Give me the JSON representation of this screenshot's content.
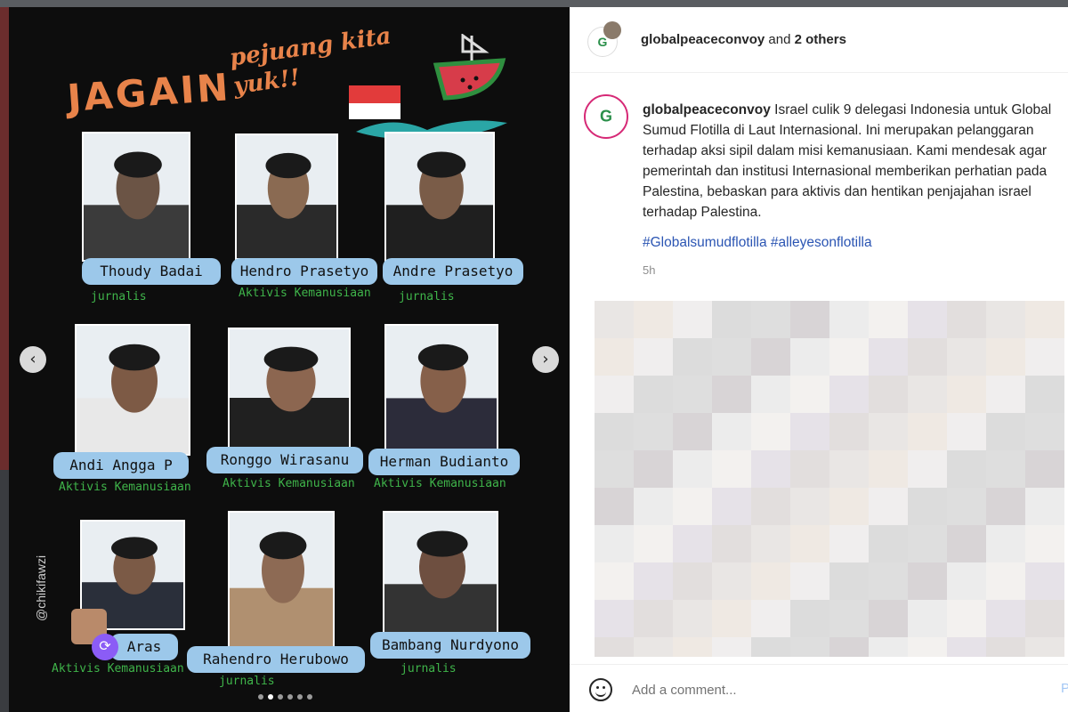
{
  "post": {
    "graphic": {
      "title": "JAGAIN",
      "subtitle": "pejuang kita yuk!!",
      "watermark": "@chikifawzi",
      "people": [
        {
          "name": "Thoudy Badai",
          "role": "jurnalis"
        },
        {
          "name": "Hendro Prasetyo",
          "role": "Aktivis Kemanusiaan"
        },
        {
          "name": "Andre Prasetyo",
          "role": "jurnalis"
        },
        {
          "name": "Andi Angga P",
          "role": "Aktivis Kemanusiaan"
        },
        {
          "name": "Ronggo Wirasanu",
          "role": "Aktivis Kemanusiaan"
        },
        {
          "name": "Herman Budianto",
          "role": "Aktivis Kemanusiaan"
        },
        {
          "name": "Aras",
          "role": "Aktivis Kemanusiaan"
        },
        {
          "name": "Rahendro Herubowo",
          "role": "jurnalis"
        },
        {
          "name": "Bambang Nurdyono",
          "role": "jurnalis"
        }
      ],
      "carousel": {
        "total": 6,
        "active": 1
      },
      "nav": {
        "prev_icon": "chevron-left-icon",
        "next_icon": "chevron-right-icon",
        "prev": "‹",
        "next": "›"
      }
    }
  },
  "header": {
    "username": "globalpeaceconvoy",
    "collab_text": "and",
    "others": "2 others"
  },
  "caption": {
    "username": "globalpeaceconvoy",
    "text": "Israel culik 9 delegasi Indonesia untuk Global Sumud Flotilla di Laut Internasional. Ini merupakan pelanggaran terhadap aksi sipil dalam misi kemanusiaan. Kami mendesak agar pemerintah dan institusi Internasional memberikan perhatian pada Palestina, bebaskan para aktivis dan hentikan penjajahan israel terhadap Palestina.",
    "hashtags": "#Globalsumudflotilla #alleyesonflotilla",
    "time": "5h"
  },
  "comment": {
    "placeholder": "Add a comment...",
    "post_label": "P",
    "emoji_icon": "smile-icon"
  },
  "colors": {
    "hashtag": "#2b55b3",
    "brand_green": "#2a8f4a",
    "name_tag": "#9cc8ea",
    "role_text": "#3fb44a",
    "title_orange": "#e8834a"
  }
}
